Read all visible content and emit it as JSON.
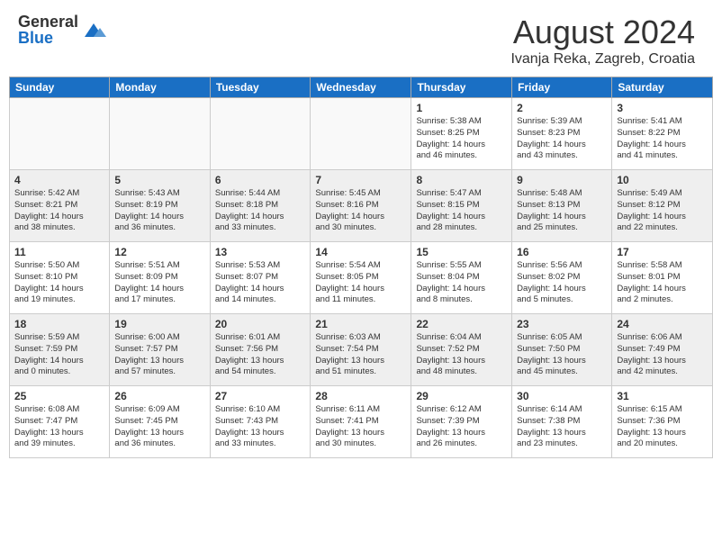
{
  "logo": {
    "general": "General",
    "blue": "Blue"
  },
  "calendar": {
    "title": "August 2024",
    "subtitle": "Ivanja Reka, Zagreb, Croatia",
    "days_of_week": [
      "Sunday",
      "Monday",
      "Tuesday",
      "Wednesday",
      "Thursday",
      "Friday",
      "Saturday"
    ],
    "weeks": [
      [
        {
          "day": "",
          "info": ""
        },
        {
          "day": "",
          "info": ""
        },
        {
          "day": "",
          "info": ""
        },
        {
          "day": "",
          "info": ""
        },
        {
          "day": "1",
          "info": "Sunrise: 5:38 AM\nSunset: 8:25 PM\nDaylight: 14 hours\nand 46 minutes."
        },
        {
          "day": "2",
          "info": "Sunrise: 5:39 AM\nSunset: 8:23 PM\nDaylight: 14 hours\nand 43 minutes."
        },
        {
          "day": "3",
          "info": "Sunrise: 5:41 AM\nSunset: 8:22 PM\nDaylight: 14 hours\nand 41 minutes."
        }
      ],
      [
        {
          "day": "4",
          "info": "Sunrise: 5:42 AM\nSunset: 8:21 PM\nDaylight: 14 hours\nand 38 minutes."
        },
        {
          "day": "5",
          "info": "Sunrise: 5:43 AM\nSunset: 8:19 PM\nDaylight: 14 hours\nand 36 minutes."
        },
        {
          "day": "6",
          "info": "Sunrise: 5:44 AM\nSunset: 8:18 PM\nDaylight: 14 hours\nand 33 minutes."
        },
        {
          "day": "7",
          "info": "Sunrise: 5:45 AM\nSunset: 8:16 PM\nDaylight: 14 hours\nand 30 minutes."
        },
        {
          "day": "8",
          "info": "Sunrise: 5:47 AM\nSunset: 8:15 PM\nDaylight: 14 hours\nand 28 minutes."
        },
        {
          "day": "9",
          "info": "Sunrise: 5:48 AM\nSunset: 8:13 PM\nDaylight: 14 hours\nand 25 minutes."
        },
        {
          "day": "10",
          "info": "Sunrise: 5:49 AM\nSunset: 8:12 PM\nDaylight: 14 hours\nand 22 minutes."
        }
      ],
      [
        {
          "day": "11",
          "info": "Sunrise: 5:50 AM\nSunset: 8:10 PM\nDaylight: 14 hours\nand 19 minutes."
        },
        {
          "day": "12",
          "info": "Sunrise: 5:51 AM\nSunset: 8:09 PM\nDaylight: 14 hours\nand 17 minutes."
        },
        {
          "day": "13",
          "info": "Sunrise: 5:53 AM\nSunset: 8:07 PM\nDaylight: 14 hours\nand 14 minutes."
        },
        {
          "day": "14",
          "info": "Sunrise: 5:54 AM\nSunset: 8:05 PM\nDaylight: 14 hours\nand 11 minutes."
        },
        {
          "day": "15",
          "info": "Sunrise: 5:55 AM\nSunset: 8:04 PM\nDaylight: 14 hours\nand 8 minutes."
        },
        {
          "day": "16",
          "info": "Sunrise: 5:56 AM\nSunset: 8:02 PM\nDaylight: 14 hours\nand 5 minutes."
        },
        {
          "day": "17",
          "info": "Sunrise: 5:58 AM\nSunset: 8:01 PM\nDaylight: 14 hours\nand 2 minutes."
        }
      ],
      [
        {
          "day": "18",
          "info": "Sunrise: 5:59 AM\nSunset: 7:59 PM\nDaylight: 14 hours\nand 0 minutes."
        },
        {
          "day": "19",
          "info": "Sunrise: 6:00 AM\nSunset: 7:57 PM\nDaylight: 13 hours\nand 57 minutes."
        },
        {
          "day": "20",
          "info": "Sunrise: 6:01 AM\nSunset: 7:56 PM\nDaylight: 13 hours\nand 54 minutes."
        },
        {
          "day": "21",
          "info": "Sunrise: 6:03 AM\nSunset: 7:54 PM\nDaylight: 13 hours\nand 51 minutes."
        },
        {
          "day": "22",
          "info": "Sunrise: 6:04 AM\nSunset: 7:52 PM\nDaylight: 13 hours\nand 48 minutes."
        },
        {
          "day": "23",
          "info": "Sunrise: 6:05 AM\nSunset: 7:50 PM\nDaylight: 13 hours\nand 45 minutes."
        },
        {
          "day": "24",
          "info": "Sunrise: 6:06 AM\nSunset: 7:49 PM\nDaylight: 13 hours\nand 42 minutes."
        }
      ],
      [
        {
          "day": "25",
          "info": "Sunrise: 6:08 AM\nSunset: 7:47 PM\nDaylight: 13 hours\nand 39 minutes."
        },
        {
          "day": "26",
          "info": "Sunrise: 6:09 AM\nSunset: 7:45 PM\nDaylight: 13 hours\nand 36 minutes."
        },
        {
          "day": "27",
          "info": "Sunrise: 6:10 AM\nSunset: 7:43 PM\nDaylight: 13 hours\nand 33 minutes."
        },
        {
          "day": "28",
          "info": "Sunrise: 6:11 AM\nSunset: 7:41 PM\nDaylight: 13 hours\nand 30 minutes."
        },
        {
          "day": "29",
          "info": "Sunrise: 6:12 AM\nSunset: 7:39 PM\nDaylight: 13 hours\nand 26 minutes."
        },
        {
          "day": "30",
          "info": "Sunrise: 6:14 AM\nSunset: 7:38 PM\nDaylight: 13 hours\nand 23 minutes."
        },
        {
          "day": "31",
          "info": "Sunrise: 6:15 AM\nSunset: 7:36 PM\nDaylight: 13 hours\nand 20 minutes."
        }
      ]
    ]
  }
}
